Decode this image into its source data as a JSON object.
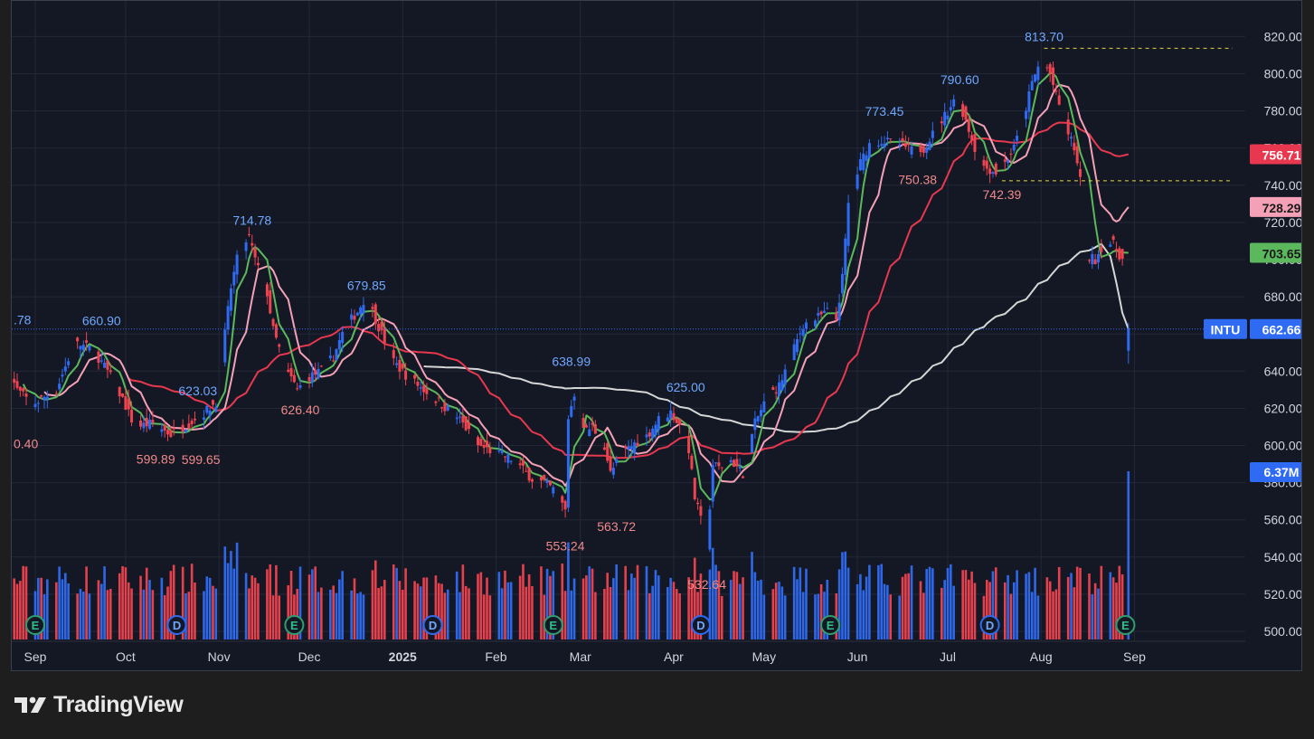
{
  "footer": {
    "brand": "TradingView"
  },
  "colors": {
    "background": "#141824",
    "grid": "#232838",
    "up": "#2f6bf2",
    "down": "#ef4350",
    "ma_green": "#5cb85c",
    "ma_pink": "#f4a1b8",
    "ma_red": "#e8384f",
    "ma_white": "#d6d6d6",
    "axis_text": "#d1d4dc",
    "high_label": "#6fa8ff",
    "low_label": "#f08a8a",
    "event_earnings": "#2e9e6e",
    "event_dividend": "#2f6bf2"
  },
  "chart_data": {
    "type": "candlestick",
    "symbol": "INTU",
    "y_axis": {
      "ticks": [
        "500.00",
        "520.00",
        "540.00",
        "560.00",
        "580.00",
        "600.00",
        "620.00",
        "640.00",
        "660.00",
        "680.00",
        "700.00",
        "720.00",
        "740.00",
        "760.00",
        "780.00",
        "800.00",
        "820.00"
      ],
      "ylim": [
        497,
        824
      ]
    },
    "x_axis": {
      "months": [
        {
          "label": "Sep",
          "day": 0
        },
        {
          "label": "Oct",
          "day": 30
        },
        {
          "label": "Nov",
          "day": 61
        },
        {
          "label": "Dec",
          "day": 91
        },
        {
          "label": "2025",
          "day": 122,
          "bold": true
        },
        {
          "label": "Feb",
          "day": 153
        },
        {
          "label": "Mar",
          "day": 181
        },
        {
          "label": "Apr",
          "day": 212
        },
        {
          "label": "May",
          "day": 242
        },
        {
          "label": "Jun",
          "day": 273
        },
        {
          "label": "Jul",
          "day": 303
        },
        {
          "label": "Aug",
          "day": 334
        },
        {
          "label": "Sep",
          "day": 365
        }
      ]
    },
    "price_path": [
      [
        -10,
        648
      ],
      [
        -5,
        630
      ],
      [
        0,
        622
      ],
      [
        8,
        630
      ],
      [
        14,
        655
      ],
      [
        20,
        652
      ],
      [
        25,
        640
      ],
      [
        30,
        625
      ],
      [
        34,
        610
      ],
      [
        40,
        612
      ],
      [
        46,
        606
      ],
      [
        52,
        612
      ],
      [
        56,
        616
      ],
      [
        60,
        622
      ],
      [
        62,
        625
      ],
      [
        64,
        660
      ],
      [
        66,
        685
      ],
      [
        68,
        700
      ],
      [
        70,
        708
      ],
      [
        72,
        712
      ],
      [
        74,
        700
      ],
      [
        76,
        690
      ],
      [
        78,
        682
      ],
      [
        80,
        662
      ],
      [
        82,
        652
      ],
      [
        84,
        640
      ],
      [
        86,
        636
      ],
      [
        88,
        630
      ],
      [
        92,
        637
      ],
      [
        96,
        640
      ],
      [
        100,
        648
      ],
      [
        104,
        664
      ],
      [
        108,
        672
      ],
      [
        110,
        678
      ],
      [
        112,
        676
      ],
      [
        114,
        668
      ],
      [
        116,
        660
      ],
      [
        120,
        645
      ],
      [
        124,
        638
      ],
      [
        130,
        630
      ],
      [
        136,
        622
      ],
      [
        142,
        614
      ],
      [
        148,
        600
      ],
      [
        154,
        596
      ],
      [
        160,
        592
      ],
      [
        166,
        582
      ],
      [
        170,
        580
      ],
      [
        174,
        575
      ],
      [
        177,
        565
      ],
      [
        178,
        615
      ],
      [
        180,
        628
      ],
      [
        182,
        615
      ],
      [
        184,
        608
      ],
      [
        186,
        610
      ],
      [
        190,
        600
      ],
      [
        192,
        585
      ],
      [
        196,
        596
      ],
      [
        200,
        601
      ],
      [
        204,
        605
      ],
      [
        208,
        614
      ],
      [
        212,
        618
      ],
      [
        216,
        608
      ],
      [
        218,
        598
      ],
      [
        220,
        572
      ],
      [
        222,
        560
      ],
      [
        224,
        545
      ],
      [
        226,
        590
      ],
      [
        228,
        588
      ],
      [
        232,
        592
      ],
      [
        236,
        585
      ],
      [
        240,
        612
      ],
      [
        244,
        626
      ],
      [
        248,
        632
      ],
      [
        252,
        648
      ],
      [
        256,
        665
      ],
      [
        260,
        668
      ],
      [
        264,
        672
      ],
      [
        267,
        668
      ],
      [
        269,
        690
      ],
      [
        271,
        730
      ],
      [
        275,
        752
      ],
      [
        278,
        762
      ],
      [
        282,
        764
      ],
      [
        288,
        762
      ],
      [
        292,
        759
      ],
      [
        296,
        760
      ],
      [
        300,
        770
      ],
      [
        304,
        780
      ],
      [
        307,
        788
      ],
      [
        310,
        775
      ],
      [
        313,
        760
      ],
      [
        316,
        750
      ],
      [
        320,
        747
      ],
      [
        323,
        752
      ],
      [
        326,
        760
      ],
      [
        329,
        775
      ],
      [
        332,
        795
      ],
      [
        335,
        808
      ],
      [
        338,
        800
      ],
      [
        340,
        788
      ],
      [
        342,
        778
      ],
      [
        344,
        768
      ],
      [
        346,
        760
      ],
      [
        348,
        742
      ],
      [
        350,
        702
      ],
      [
        353,
        700
      ],
      [
        356,
        710
      ],
      [
        359,
        708
      ],
      [
        362,
        700
      ]
    ],
    "last_candle": {
      "day": 363,
      "open": 651,
      "high": 666,
      "low": 644,
      "close": 662.66
    },
    "ma_current": {
      "green": 703.65,
      "pink": 728.29,
      "red": 756.71,
      "white": 662.66
    },
    "ma_periods": {
      "green": 5,
      "pink": 10,
      "red": 30,
      "white": 100
    },
    "high_labels": [
      {
        "text": "660.90",
        "day": 22,
        "price": 660.9
      },
      {
        "text": "623.03",
        "day": 54,
        "price": 623.03
      },
      {
        "text": "714.78",
        "day": 72,
        "price": 714.78
      },
      {
        "text": "679.85",
        "day": 110,
        "price": 679.85
      },
      {
        "text": "638.99",
        "day": 178,
        "price": 638.99
      },
      {
        "text": "625.00",
        "day": 216,
        "price": 625.0
      },
      {
        "text": "773.45",
        "day": 282,
        "price": 773.45
      },
      {
        "text": "790.60",
        "day": 307,
        "price": 790.6
      },
      {
        "text": "813.70",
        "day": 335,
        "price": 813.7
      }
    ],
    "low_labels": [
      {
        "text": "599.89",
        "day": 40,
        "price": 599.89
      },
      {
        "text": "599.65",
        "day": 55,
        "price": 599.65
      },
      {
        "text": "626.40",
        "day": 88,
        "price": 626.4
      },
      {
        "text": "553.24",
        "day": 176,
        "price": 553.24
      },
      {
        "text": "563.72",
        "day": 193,
        "price": 563.72
      },
      {
        "text": "532.64",
        "day": 223,
        "price": 532.64
      },
      {
        "text": "750.38",
        "day": 293,
        "price": 750.38
      },
      {
        "text": "742.39",
        "day": 321,
        "price": 742.39
      }
    ],
    "edge_labels": [
      {
        "text": ".78",
        "price": 664.78
      },
      {
        "text": "0.40",
        "price": 606.4
      }
    ],
    "dashed_levels": [
      813.7,
      742.39
    ],
    "price_labels": [
      {
        "text": "756.71",
        "price": 756.71,
        "color": "#e8384f",
        "text_color": "#ffffff"
      },
      {
        "text": "728.29",
        "price": 728.29,
        "color": "#f4a1b8",
        "text_color": "#1a1a1a"
      },
      {
        "text": "703.65",
        "price": 703.65,
        "color": "#5cb85c",
        "text_color": "#1a1a1a"
      },
      {
        "text": "662.66",
        "price": 662.66,
        "color": "#2f6bf2",
        "text_color": "#ffffff"
      }
    ],
    "symbol_tag": "INTU",
    "volume_label": "6.37M",
    "events": [
      {
        "type": "E",
        "day": 0
      },
      {
        "type": "D",
        "day": 47
      },
      {
        "type": "E",
        "day": 86
      },
      {
        "type": "D",
        "day": 132
      },
      {
        "type": "E",
        "day": 172
      },
      {
        "type": "D",
        "day": 221
      },
      {
        "type": "E",
        "day": 264
      },
      {
        "type": "D",
        "day": 317
      },
      {
        "type": "E",
        "day": 362
      }
    ]
  }
}
